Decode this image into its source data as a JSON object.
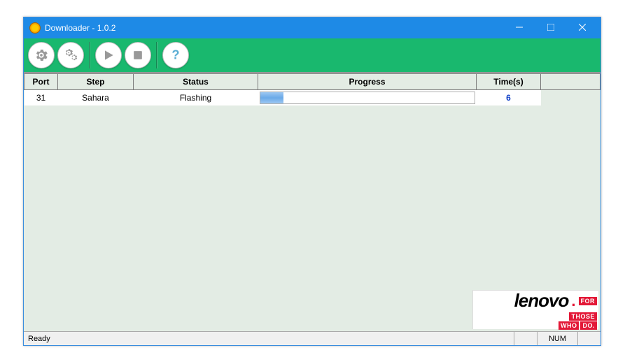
{
  "window": {
    "title": "Downloader - 1.0.2"
  },
  "toolbar": {
    "settings": "settings",
    "advanced_settings": "advanced-settings",
    "start": "start",
    "stop": "stop",
    "help": "help"
  },
  "table": {
    "headers": {
      "port": "Port",
      "step": "Step",
      "status": "Status",
      "progress": "Progress",
      "time": "Time(s)"
    },
    "rows": [
      {
        "port": "31",
        "step": "Sahara",
        "status": "Flashing",
        "progress_percent": 11,
        "time": "6"
      }
    ]
  },
  "statusbar": {
    "ready": "Ready",
    "num": "NUM"
  },
  "branding": {
    "name": "lenovo",
    "tagline1": "FOR",
    "tagline2": "THOSE",
    "tagline3": "WHO",
    "tagline4": "DO."
  }
}
